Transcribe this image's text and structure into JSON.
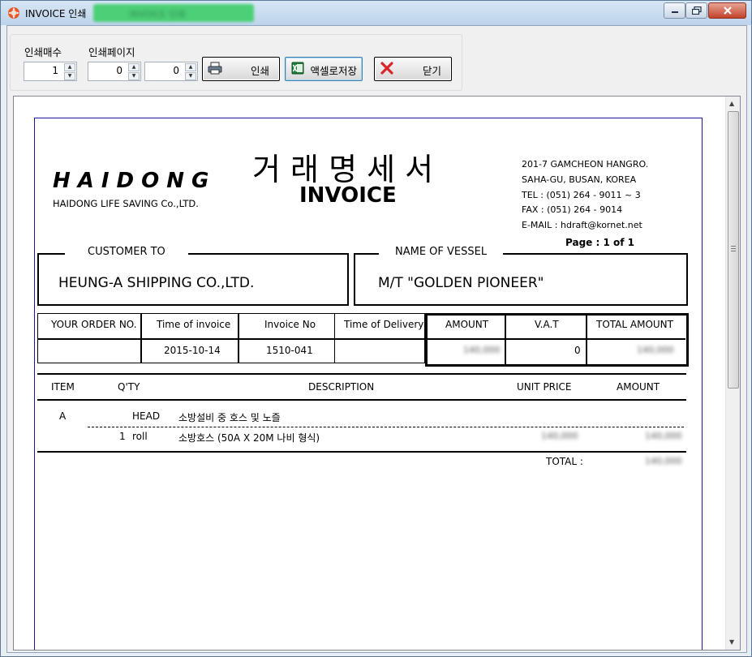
{
  "window": {
    "title": "INVOICE 인쇄",
    "title_extra": "INVOICE 인쇄"
  },
  "toolbar": {
    "copies_label": "인쇄매수",
    "pages_label": "인쇄페이지",
    "copies_value": "1",
    "page_from_value": "0",
    "page_to_value": "0",
    "print_label": "인쇄",
    "excel_label": "액셀로저장",
    "close_label": "닫기"
  },
  "invoice": {
    "company_logo": "HAIDONG",
    "company_name": "HAIDONG LIFE SAVING Co.,LTD.",
    "title_kr": "거 래 명 세 서",
    "title_en": "INVOICE",
    "address1": "201-7 GAMCHEON HANGRO.",
    "address2": "SAHA-GU, BUSAN, KOREA",
    "tel": "TEL : (051) 264 - 9011 ~ 3",
    "fax": "FAX : (051) 264 - 9014",
    "email": "E-MAIL : hdraft@kornet.net",
    "page_info": "Page : 1 of 1",
    "customer_label": "CUSTOMER TO",
    "customer": "HEUNG-A SHIPPING CO.,LTD.",
    "vessel_label": "NAME OF VESSEL",
    "vessel": "M/T \"GOLDEN PIONEER\"",
    "headers": {
      "order_no": "YOUR ORDER NO.",
      "time_of_invoice": "Time of invoice",
      "invoice_no": "Invoice No",
      "time_of_delivery": "Time of Delivery",
      "amount": "AMOUNT",
      "vat": "V.A.T",
      "total_amount": "TOTAL AMOUNT"
    },
    "values": {
      "order_no": "",
      "time_of_invoice": "2015-10-14",
      "invoice_no": "1510-041",
      "time_of_delivery": "",
      "amount": "140,000",
      "vat": "0",
      "total_amount": "140,000"
    },
    "items_headers": {
      "item": "ITEM",
      "qty": "Q'TY",
      "description": "DESCRIPTION",
      "unit_price": "UNIT PRICE",
      "amount": "AMOUNT"
    },
    "group": {
      "item": "A",
      "unit": "HEAD",
      "description": "소방설비 중 호스 및 노즐"
    },
    "line": {
      "qty": "1",
      "unit": "roll",
      "description": "소방호스 (50A X 20M 나비 형식)",
      "unit_price": "140,000",
      "amount": "140,000"
    },
    "total_label": "TOTAL :",
    "total_value": "140,000"
  }
}
